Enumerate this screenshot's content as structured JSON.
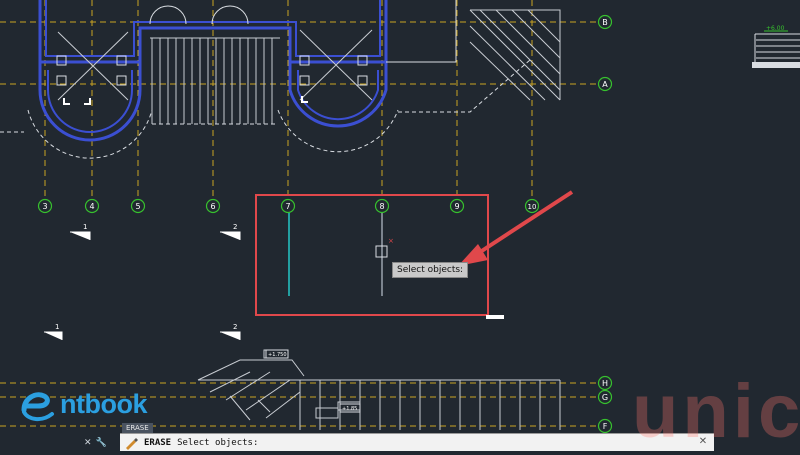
{
  "window": {
    "title": ""
  },
  "grid": {
    "vertical": [
      {
        "label": "3"
      },
      {
        "label": "4"
      },
      {
        "label": "5"
      },
      {
        "label": "6"
      },
      {
        "label": "7"
      },
      {
        "label": "8"
      },
      {
        "label": "9"
      },
      {
        "label": "10"
      }
    ],
    "horizontal": [
      {
        "label": "B"
      },
      {
        "label": "A"
      },
      {
        "label": "H"
      },
      {
        "label": "G"
      },
      {
        "label": "F"
      }
    ]
  },
  "section_marks": [
    {
      "label": "1"
    },
    {
      "label": "2"
    },
    {
      "label": "1"
    },
    {
      "label": "2"
    }
  ],
  "elevation_tags": [
    "+6.00",
    "+1.750",
    "+1.85"
  ],
  "selection": {
    "tooltip": "Select objects:",
    "border_color": "#e0484b",
    "arrow_color": "#e0484b"
  },
  "command_line": {
    "tab_label": "ERASE",
    "command": "ERASE",
    "prompt": "Select objects:",
    "close_icon": "close-icon",
    "tools": [
      "close-x-icon",
      "wrench-icon"
    ]
  },
  "logo": {
    "text": "ntbook",
    "icon": "swoosh-e-logo-icon"
  },
  "watermark": {
    "text": "unic"
  },
  "colors": {
    "background": "#212830",
    "wall": "#3b4fd2",
    "grid_line": "#c9a322",
    "grid_bubble": "#37c12e",
    "white_line": "#d9dde2",
    "cyan_line": "#24c7c7"
  }
}
